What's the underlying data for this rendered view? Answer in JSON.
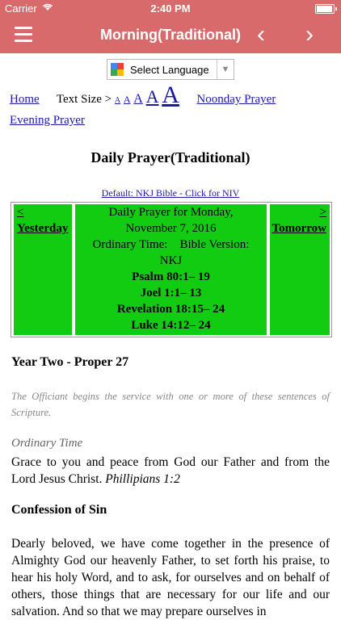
{
  "status": {
    "carrier": "Carrier",
    "time": "2:40 PM"
  },
  "nav": {
    "title": "Morning(Traditional)",
    "prev_glyph": "‹",
    "next_glyph": "›"
  },
  "language": {
    "label": "Select Language"
  },
  "links": {
    "home": "Home",
    "text_size_label": "Text Size >",
    "sizes": [
      "A",
      "A",
      "A",
      "A",
      "A"
    ],
    "noonday": "Noonday Prayer",
    "evening": "Evening Prayer"
  },
  "heading": "Daily Prayer(Traditional)",
  "bible_link": "Default: NKJ Bible - Click for NIV",
  "day_table": {
    "left_glyph": "<",
    "yesterday": "Yesterday",
    "right_glyph": ">",
    "tomorrow": "Tomorrow",
    "line1": "Daily Prayer for Monday,",
    "line2": "November 7, 2016",
    "line3": "Ordinary Time:    Bible Version:",
    "line4": "NKJ",
    "readings": [
      "Psalm 80:1– 19",
      "Joel 1:1– 13",
      "Revelation 18:15– 24",
      "Luke 14:12– 24"
    ]
  },
  "content": {
    "year": "Year Two - Proper 27",
    "rubric": "The Officiant begins the service with one or more of these sentences of Scripture.",
    "season": "Ordinary Time",
    "sentence": "Grace to you and peace from God our Father and from the Lord Jesus Christ.",
    "sentence_ref": "Phillipians 1:2",
    "section_title": "Confession of Sin",
    "exhortation": "Dearly beloved, we have come together in the presence of Almighty God our heavenly Father, to set forth his praise, to hear his holy Word, and to ask, for ourselves and on behalf of others, those things that are necessary for our life and our salvation. And so that we may prepare ourselves in"
  },
  "colors": {
    "accent": "#d96a6b",
    "day_cell": "#12cc12",
    "link": "#1a1aa6"
  }
}
